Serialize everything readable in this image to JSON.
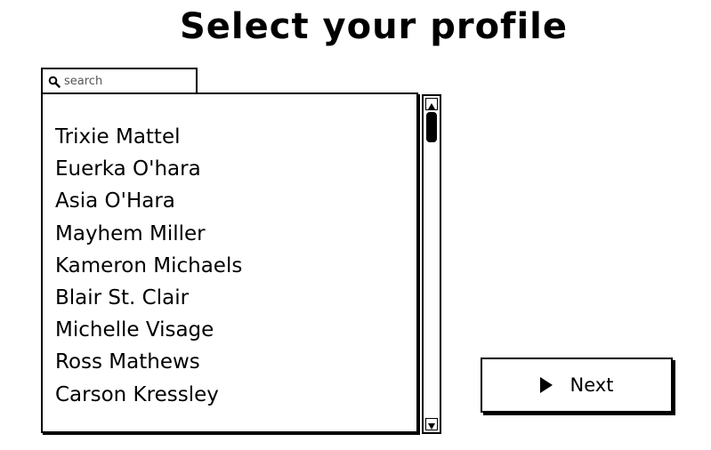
{
  "header": {
    "title": "Select your profile"
  },
  "search": {
    "placeholder": "search",
    "icon": "search-icon"
  },
  "profiles": {
    "items": [
      "Trixie Mattel",
      "Euerka O'hara",
      "Asia O'Hara",
      "Mayhem Miller",
      "Kameron Michaels",
      "Blair St. Clair",
      "Michelle Visage",
      "Ross Mathews",
      "Carson Kressley"
    ]
  },
  "actions": {
    "next_label": "Next",
    "next_icon": "play-icon"
  }
}
